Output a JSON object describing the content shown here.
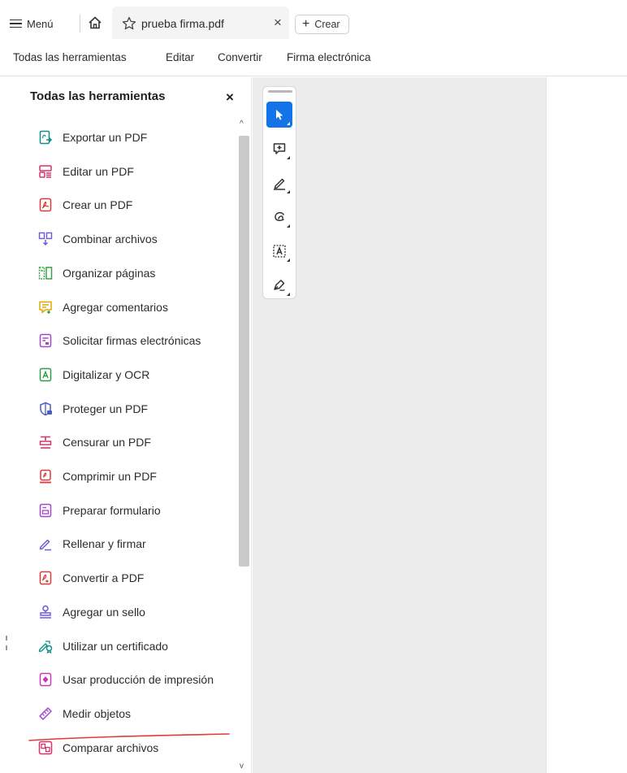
{
  "tabbar": {
    "menu_label": "Menú",
    "document_tab": "prueba firma.pdf",
    "create_label": "Crear"
  },
  "topnav": {
    "items": [
      "Todas las herramientas",
      "Editar",
      "Convertir",
      "Firma electrónica"
    ]
  },
  "panel": {
    "title": "Todas las herramientas",
    "tools": [
      {
        "label": "Exportar un PDF",
        "icon": "export-pdf-icon",
        "color": "#0f8f86"
      },
      {
        "label": "Editar un PDF",
        "icon": "edit-pdf-icon",
        "color": "#d6336c"
      },
      {
        "label": "Crear un PDF",
        "icon": "create-pdf-icon",
        "color": "#e03a3a"
      },
      {
        "label": "Combinar archivos",
        "icon": "combine-files-icon",
        "color": "#6b5bd6"
      },
      {
        "label": "Organizar páginas",
        "icon": "organize-pages-icon",
        "color": "#37a146"
      },
      {
        "label": "Agregar comentarios",
        "icon": "comment-icon",
        "color": "#e0a800"
      },
      {
        "label": "Solicitar firmas electrónicas",
        "icon": "request-esign-icon",
        "color": "#a347c9"
      },
      {
        "label": "Digitalizar y OCR",
        "icon": "scan-ocr-icon",
        "color": "#2e9e44"
      },
      {
        "label": "Proteger un PDF",
        "icon": "protect-pdf-icon",
        "color": "#4a5fc1"
      },
      {
        "label": "Censurar un PDF",
        "icon": "redact-icon",
        "color": "#d6336c"
      },
      {
        "label": "Comprimir un PDF",
        "icon": "compress-pdf-icon",
        "color": "#e03a3a"
      },
      {
        "label": "Preparar formulario",
        "icon": "prepare-form-icon",
        "color": "#a347c9"
      },
      {
        "label": "Rellenar y firmar",
        "icon": "fill-sign-icon",
        "color": "#6b5bd6"
      },
      {
        "label": "Convertir a PDF",
        "icon": "convert-pdf-icon",
        "color": "#e03a3a"
      },
      {
        "label": "Agregar un sello",
        "icon": "stamp-icon",
        "color": "#6b5bd6"
      },
      {
        "label": "Utilizar un certificado",
        "icon": "certificate-icon",
        "color": "#0f8f86"
      },
      {
        "label": "Usar producción de impresión",
        "icon": "print-production-icon",
        "color": "#c43cb5"
      },
      {
        "label": "Medir objetos",
        "icon": "measure-icon",
        "color": "#a347c9"
      },
      {
        "label": "Comparar archivos",
        "icon": "compare-files-icon",
        "color": "#d6336c"
      }
    ]
  },
  "vertical_toolbar": {
    "tools": [
      "select-pointer-icon",
      "add-comment-icon",
      "highlight-pen-icon",
      "draw-freeform-icon",
      "add-text-icon",
      "sign-icon"
    ]
  },
  "colors": {
    "accent": "#1473e6",
    "annotation_red": "#e23b3b",
    "document_bg": "#ececec"
  }
}
